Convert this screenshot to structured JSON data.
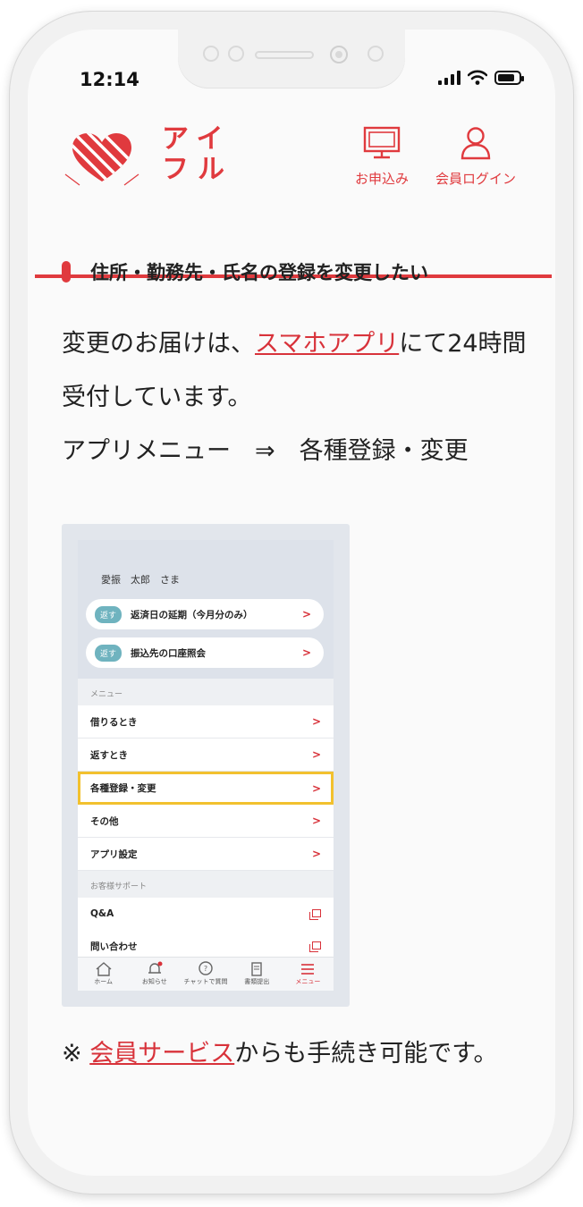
{
  "status_bar": {
    "time": "12:14"
  },
  "header": {
    "logo_text_line1": "アイ",
    "logo_text_line2": "フル",
    "apply_label": "お申込み",
    "login_label": "会員ログイン",
    "brand_color": "#e03a3e"
  },
  "section": {
    "title": "住所・勤務先・氏名の登録を変更したい"
  },
  "body": {
    "part1": "変更のお届けは、",
    "app_link": "スマホアプリ",
    "part2": "にて24時間受付しています。",
    "line3": "アプリメニュー　⇒　各種登録・変更"
  },
  "app_screenshot": {
    "user_name": "愛振　太郎　さま",
    "quick_actions": [
      {
        "tag": "返す",
        "label": "返済日の延期（今月分のみ）"
      },
      {
        "tag": "返す",
        "label": "振込先の口座照会"
      }
    ],
    "menu_label": "メニュー",
    "menu_items": [
      {
        "label": "借りるとき"
      },
      {
        "label": "返すとき"
      },
      {
        "label": "各種登録・変更",
        "highlighted": true
      },
      {
        "label": "その他"
      },
      {
        "label": "アプリ設定"
      }
    ],
    "support_label": "お客様サポート",
    "support_items": [
      {
        "label": "Q&A"
      },
      {
        "label": "問い合わせ"
      }
    ],
    "chevron": ">",
    "tabs": [
      {
        "label": "ホーム",
        "icon": "home-icon"
      },
      {
        "label": "お知らせ",
        "icon": "bell-icon"
      },
      {
        "label": "チャットで質問",
        "icon": "chat-icon"
      },
      {
        "label": "書類提出",
        "icon": "document-icon"
      },
      {
        "label": "メニュー",
        "icon": "menu-icon",
        "active": true
      }
    ]
  },
  "note": {
    "prefix": "※ ",
    "link": "会員サービス",
    "suffix": "からも手続き可能です。"
  }
}
